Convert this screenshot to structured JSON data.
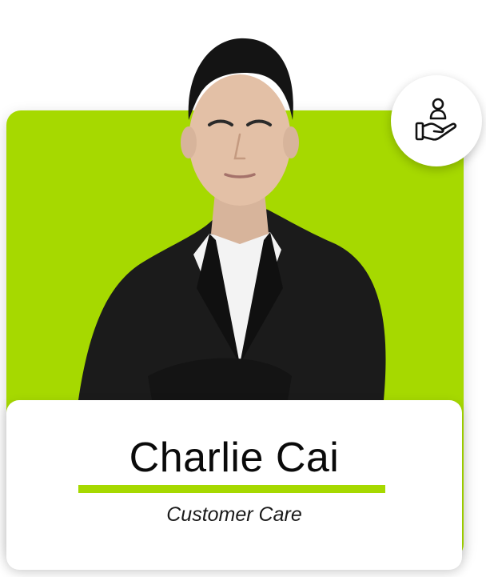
{
  "profile": {
    "name": "Charlie Cai",
    "role": "Customer Care"
  },
  "icons": {
    "badge": "customer-care-hand-icon"
  },
  "colors": {
    "accent": "#a6d900",
    "panel": "#ffffff",
    "suit": "#1b1b1b",
    "shirt": "#f3f3f3"
  }
}
